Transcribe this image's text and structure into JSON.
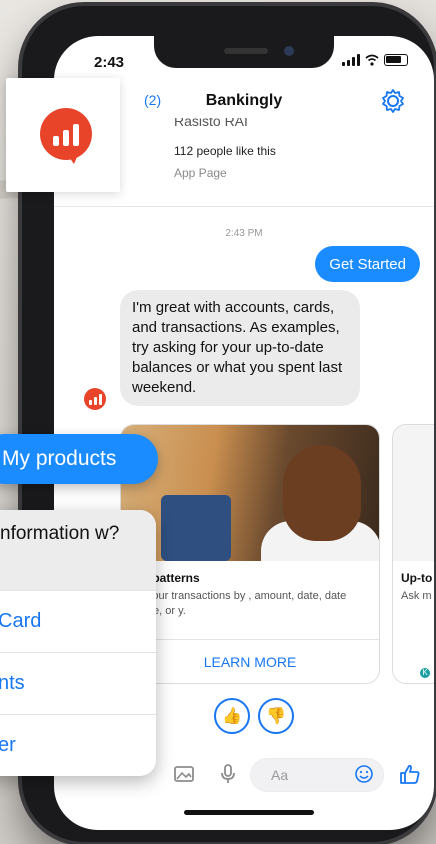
{
  "status": {
    "time": "2:43"
  },
  "header": {
    "back_count": "(2)",
    "title": "Bankingly"
  },
  "page_card": {
    "name": "Rasisto RAI",
    "likes": "112 people like this",
    "type": "App Page"
  },
  "conversation": {
    "timestamp": "2:43 PM",
    "user_message": "Get Started",
    "bot_message": "I'm great with accounts, cards, and transactions. As examples, try asking for your up-to-date balances or what you spent last weekend."
  },
  "cards": [
    {
      "title": "ing patterns",
      "desc": "for your transactions by , amount, date, date range, or y.",
      "button": "LEARN MORE"
    },
    {
      "title": "Up-to",
      "desc": "Ask m"
    }
  ],
  "mini_avatar": "K",
  "composer": {
    "placeholder": "Aa"
  },
  "overlay": {
    "my_products": "My products",
    "question": "nformation w?",
    "options": [
      "Card",
      "nts",
      "er"
    ]
  },
  "colors": {
    "accent": "#1a8cff",
    "brand": "#e8442a"
  }
}
